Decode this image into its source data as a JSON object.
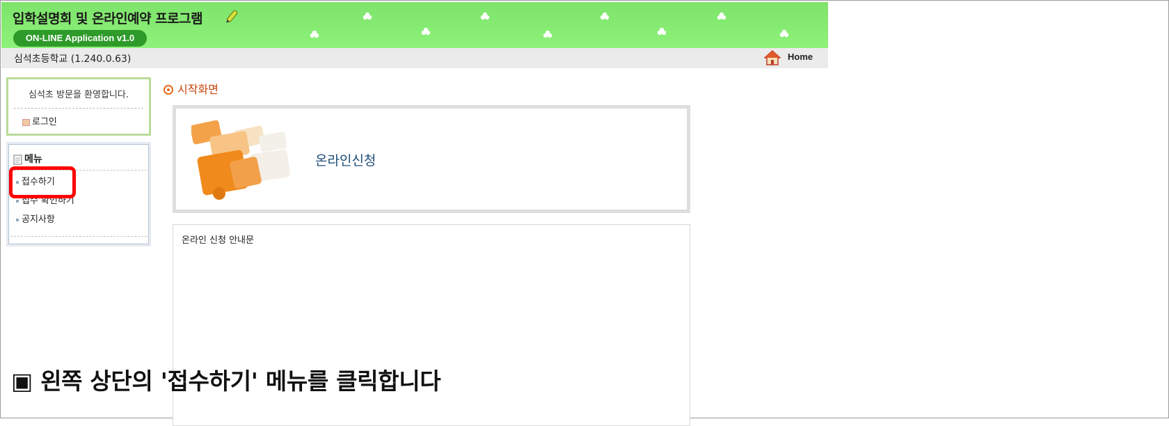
{
  "header": {
    "title": "입학설명회 및 온라인예약 프로그램",
    "version_badge": "ON-LINE Application v1.0"
  },
  "subbar": {
    "school_name": "심석초등학교 (1.240.0.63)",
    "home_label": "Home"
  },
  "login_box": {
    "welcome": "심석초 방문을 환영합니다.",
    "login_link": "로그인"
  },
  "menu": {
    "title": "메뉴",
    "items": [
      {
        "label": "접수하기"
      },
      {
        "label": "접수 확인하기"
      },
      {
        "label": "공지사항"
      }
    ]
  },
  "main": {
    "section_title": "시작화면",
    "banner_label": "온라인신청",
    "notice_title": "온라인 신청 안내문"
  },
  "caption": "▣ 왼쪽 상단의 '접수하기' 메뉴를 클릭합니다",
  "colors": {
    "header_green": "#8ef27a",
    "badge_green": "#2e9a2a",
    "highlight_red": "#ff0000",
    "section_title_orange": "#c8420a",
    "banner_text_blue": "#1e4d7a"
  }
}
